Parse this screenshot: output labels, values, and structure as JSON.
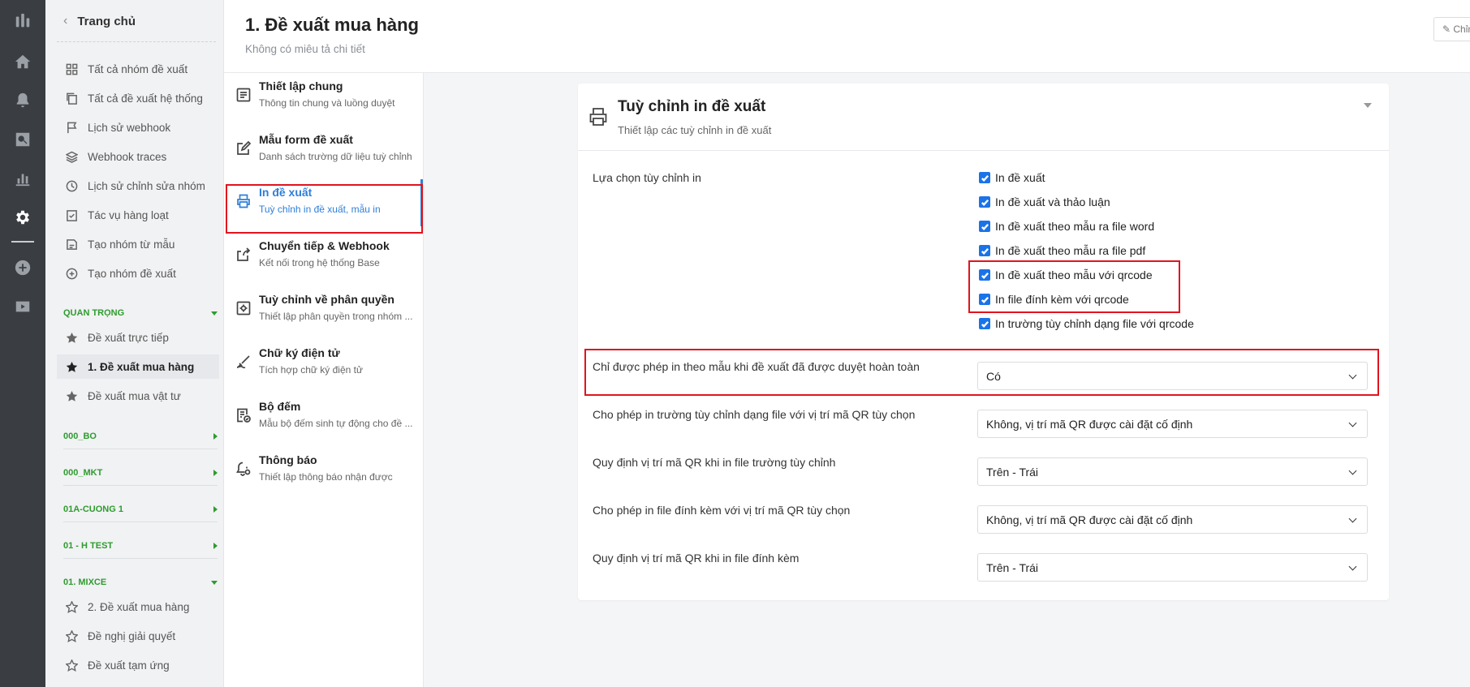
{
  "rail": {
    "icons": [
      "brand-icon",
      "home-icon",
      "bell-icon",
      "search-icon",
      "chart-icon",
      "gear-icon",
      "plus-circle-icon",
      "video-icon"
    ]
  },
  "nav": {
    "back_label": "Trang chủ",
    "items": [
      {
        "label": "Tất cả nhóm đề xuất",
        "icon": "grid-icon"
      },
      {
        "label": "Tất cả đề xuất hệ thống",
        "icon": "copy-icon"
      },
      {
        "label": "Lịch sử webhook",
        "icon": "flag-icon"
      },
      {
        "label": "Webhook traces",
        "icon": "layers-icon"
      },
      {
        "label": "Lịch sử chỉnh sửa nhóm",
        "icon": "clock-icon"
      },
      {
        "label": "Tác vụ hàng loạt",
        "icon": "checklist-icon"
      },
      {
        "label": "Tạo nhóm từ mẫu",
        "icon": "template-icon"
      },
      {
        "label": "Tạo nhóm đề xuất",
        "icon": "plus-circle-icon"
      }
    ],
    "groups": {
      "quan_trong": {
        "label": "QUAN TRỌNG",
        "items": [
          "Đề xuất trực tiếp",
          "1. Đề xuất mua hàng",
          "Đề xuất mua vật tư"
        ]
      },
      "g1": "000_BO",
      "g2": "000_MKT",
      "g3": "01A-CUONG 1",
      "g4": "01 - H TEST",
      "mixce": {
        "label": "01. MIXCE",
        "items": [
          "2. Đề xuất mua hàng",
          "Đề nghị giải quyết",
          "Đề xuất tạm ứng"
        ]
      }
    }
  },
  "header": {
    "title": "1. Đề xuất mua hàng",
    "subtitle": "Không có miêu tả chi tiết",
    "edit_label": "✎ Chỉnh sửa"
  },
  "menu": [
    {
      "title": "Thiết lập chung",
      "desc": "Thông tin chung và luồng duyệt"
    },
    {
      "title": "Mẫu form đề xuất",
      "desc": "Danh sách trường dữ liệu tuỳ chỉnh"
    },
    {
      "title": "In đề xuất",
      "desc": "Tuỳ chỉnh in đề xuất, mẫu in"
    },
    {
      "title": "Chuyển tiếp & Webhook",
      "desc": "Kết nối trong hệ thống Base"
    },
    {
      "title": "Tuỳ chỉnh về phân quyền",
      "desc": "Thiết lập phân quyền trong nhóm ..."
    },
    {
      "title": "Chữ ký điện tử",
      "desc": "Tích hợp chữ ký điện tử"
    },
    {
      "title": "Bộ đếm",
      "desc": "Mẫu bộ đếm sinh tự động cho đề ..."
    },
    {
      "title": "Thông báo",
      "desc": "Thiết lập thông báo nhận được"
    }
  ],
  "card": {
    "title": "Tuỳ chỉnh in đề xuất",
    "subtitle": "Thiết lập các tuỳ chỉnh in đề xuất",
    "print_options_label": "Lựa chọn tùy chỉnh in",
    "checkboxes": [
      {
        "label": "In đề xuất",
        "checked": true
      },
      {
        "label": "In đề xuất và thảo luận",
        "checked": true
      },
      {
        "label": "In đề xuất theo mẫu ra file word",
        "checked": true
      },
      {
        "label": "In đề xuất theo mẫu ra file pdf",
        "checked": true
      },
      {
        "label": "In đề xuất theo mẫu với qrcode",
        "checked": true
      },
      {
        "label": "In file đính kèm với qrcode",
        "checked": true
      },
      {
        "label": "In trường tùy chỉnh dạng file với qrcode",
        "checked": true
      }
    ],
    "settings": [
      {
        "label": "Chỉ được phép in theo mẫu khi đề xuất đã được duyệt hoàn toàn",
        "value": "Có"
      },
      {
        "label": "Cho phép in trường tùy chỉnh dạng file với vị trí mã QR tùy chọn",
        "value": "Không, vị trí mã QR được cài đặt cố định"
      },
      {
        "label": "Quy định vị trí mã QR khi in file trường tùy chỉnh",
        "value": "Trên - Trái"
      },
      {
        "label": "Cho phép in file đính kèm với vị trí mã QR tùy chọn",
        "value": "Không, vị trí mã QR được cài đặt cố định"
      },
      {
        "label": "Quy định vị trí mã QR khi in file đính kèm",
        "value": "Trên - Trái"
      }
    ]
  },
  "colors": {
    "rail_bg": "#3a3d42",
    "active_blue": "#2f7fd8",
    "group_green": "#2e9c2e",
    "highlight_red": "#e0141e",
    "checkbox_blue": "#1a73e8"
  }
}
